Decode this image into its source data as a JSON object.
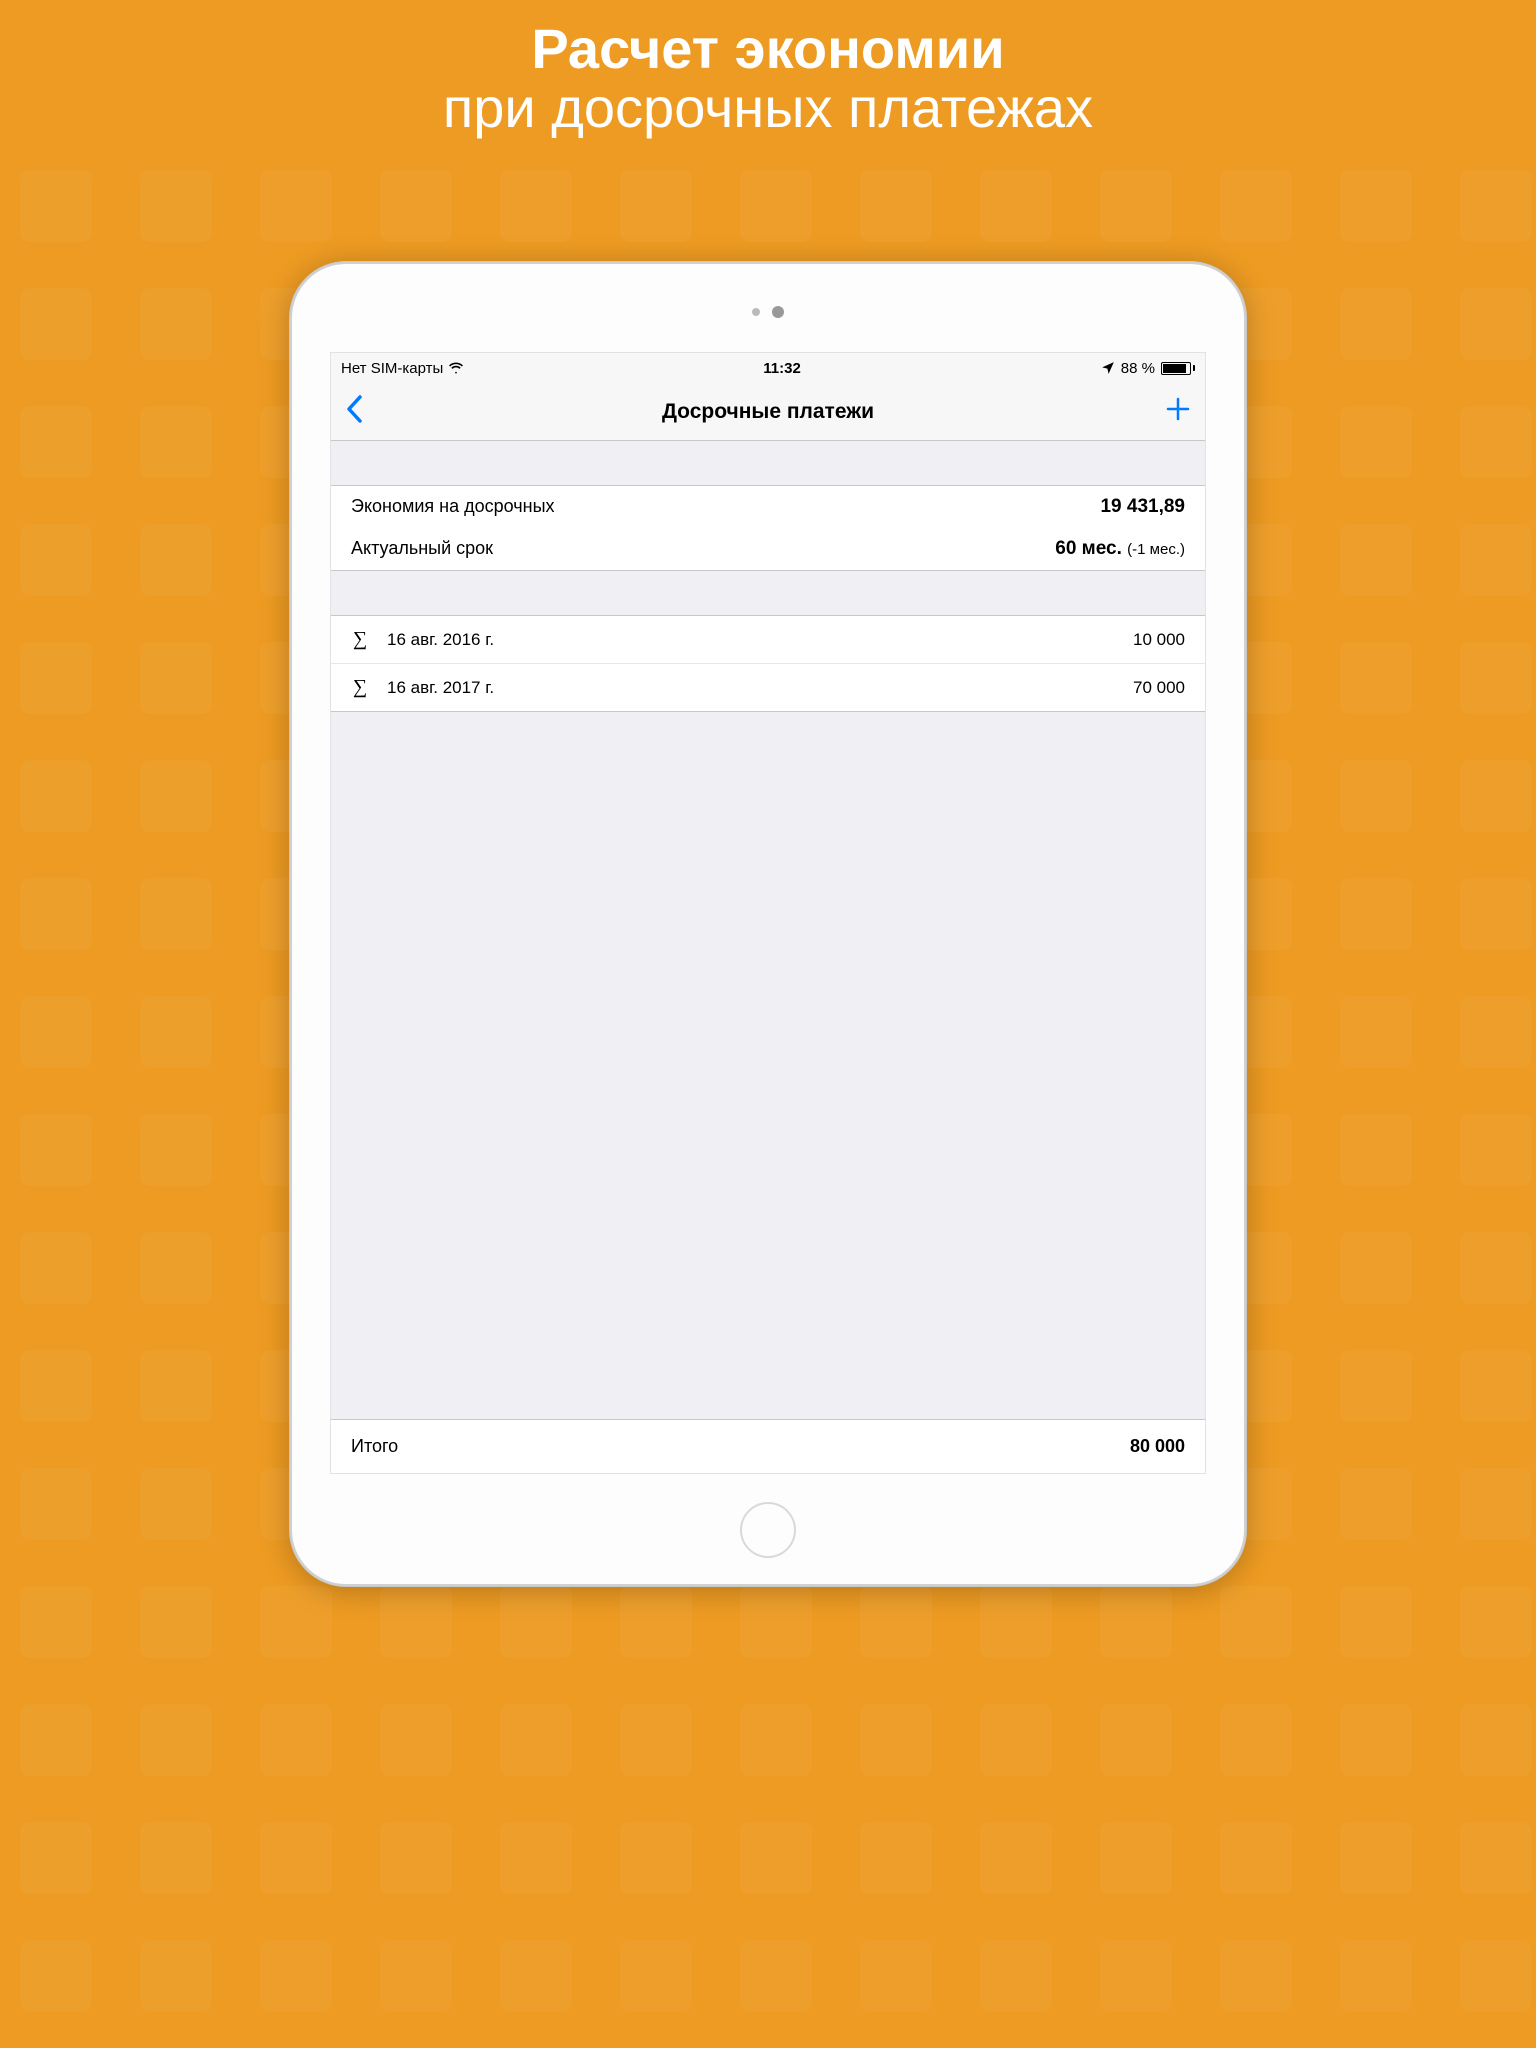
{
  "marketing": {
    "line1": "Расчет экономии",
    "line2": "при досрочных платежах"
  },
  "status_bar": {
    "carrier": "Нет SIM-карты",
    "time": "11:32",
    "battery_percent": "88 %"
  },
  "nav": {
    "title": "Досрочные платежи"
  },
  "summary": {
    "savings_label": "Экономия на досрочных",
    "savings_value": "19 431,89",
    "term_label": "Актуальный срок",
    "term_value": "60 мес.",
    "term_delta": "(-1 мес.)"
  },
  "payments": [
    {
      "date": "16 авг. 2016 г.",
      "amount": "10 000"
    },
    {
      "date": "16 авг. 2017 г.",
      "amount": "70 000"
    }
  ],
  "total": {
    "label": "Итого",
    "value": "80 000"
  }
}
